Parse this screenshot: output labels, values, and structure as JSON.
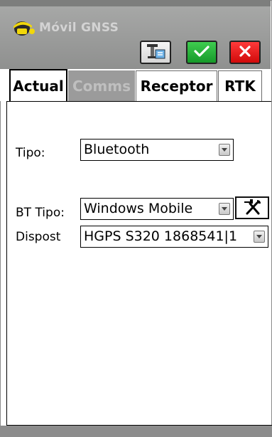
{
  "window": {
    "title": "Móvil GNSS"
  },
  "toolbar": {
    "antenna_icon": "antenna-settings-icon",
    "ok_icon": "check-icon",
    "cancel_icon": "close-icon"
  },
  "tabs": [
    {
      "label": "Actual",
      "state": "active"
    },
    {
      "label": "Comms",
      "state": "disabled"
    },
    {
      "label": "Receptor",
      "state": "normal"
    },
    {
      "label": "RTK",
      "state": "normal"
    }
  ],
  "form": {
    "tipo": {
      "label": "Tipo:",
      "value": "Bluetooth"
    },
    "bt_tipo": {
      "label": "BT Tipo:",
      "value": "Windows Mobile"
    },
    "dispost": {
      "label": "Dispost",
      "value": "HGPS S320 1868541|1"
    },
    "tools_icon": "hammer-wrench-icon"
  },
  "colors": {
    "ok": "#1fae33",
    "cancel": "#e31414",
    "header": "#9c9d9c",
    "disabled_tab": "#9b9b9b"
  }
}
